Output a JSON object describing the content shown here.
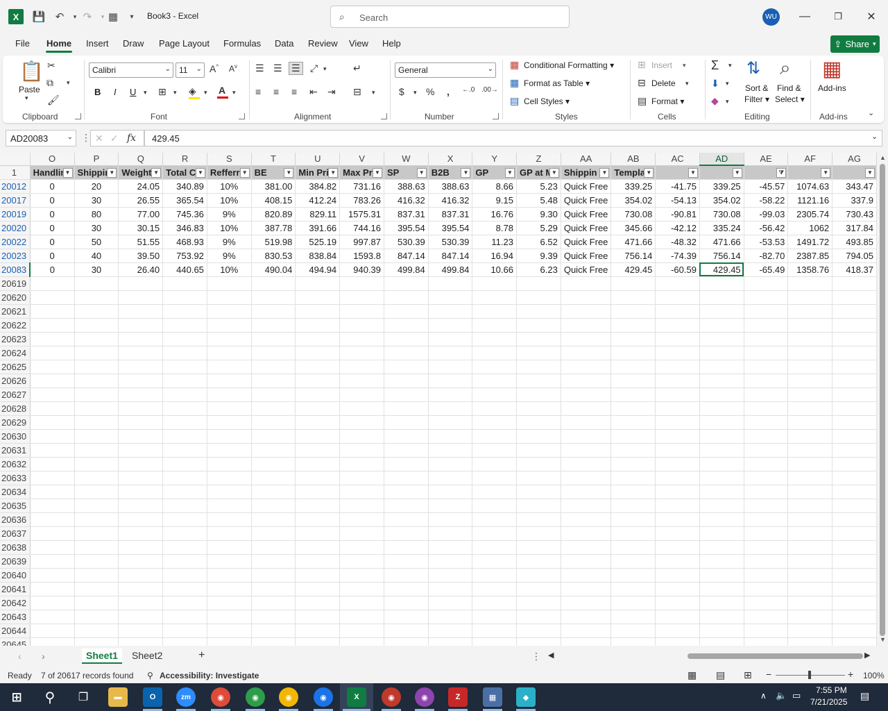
{
  "window": {
    "title": "Book3  -  Excel",
    "search_placeholder": "Search",
    "user_initials": "WU"
  },
  "menu": {
    "tabs": [
      "File",
      "Home",
      "Insert",
      "Draw",
      "Page Layout",
      "Formulas",
      "Data",
      "Review",
      "View",
      "Help"
    ],
    "active": "Home",
    "share_label": "Share"
  },
  "ribbon": {
    "clipboard": {
      "paste": "Paste",
      "group": "Clipboard"
    },
    "font": {
      "name": "Calibri",
      "size": "11",
      "bold": "B",
      "italic": "I",
      "underline": "U",
      "group": "Font"
    },
    "alignment": {
      "group": "Alignment"
    },
    "number": {
      "format": "General",
      "group": "Number"
    },
    "styles": {
      "conditional": "Conditional Formatting",
      "format_table": "Format as Table",
      "cell_styles": "Cell Styles",
      "group": "Styles"
    },
    "cells": {
      "insert": "Insert",
      "delete": "Delete",
      "format": "Format",
      "group": "Cells"
    },
    "editing": {
      "sort": "Sort &",
      "sort2": "Filter",
      "find": "Find &",
      "find2": "Select",
      "group": "Editing"
    },
    "addins": {
      "label": "Add-ins",
      "group": "Add-ins"
    }
  },
  "formula_bar": {
    "name_box": "AD20083",
    "fx": "fx",
    "value": "429.45"
  },
  "grid": {
    "columns": [
      "O",
      "P",
      "Q",
      "R",
      "S",
      "T",
      "U",
      "V",
      "W",
      "X",
      "Y",
      "Z",
      "AA",
      "AB",
      "AC",
      "AD",
      "AE",
      "AF",
      "AG"
    ],
    "selected_column": "AD",
    "header_row": {
      "row_num": "1",
      "cells": [
        "Handlin",
        "Shippin",
        "Weight",
        "Total C",
        "Refferr",
        "BE",
        "Min Pri",
        "Max Pr",
        "SP",
        "B2B",
        "GP",
        "GP at M",
        "Shippin",
        "Templat",
        "",
        "",
        "",
        "",
        ""
      ]
    },
    "rows": [
      {
        "num": "20012",
        "cells": [
          "0",
          "20",
          "24.05",
          "340.89",
          "10%",
          "381.00",
          "384.82",
          "731.16",
          "388.63",
          "388.63",
          "8.66",
          "5.23",
          "Quick Free",
          "339.25",
          "-41.75",
          "339.25",
          "-45.57",
          "1074.63",
          "343.47"
        ]
      },
      {
        "num": "20017",
        "cells": [
          "0",
          "30",
          "26.55",
          "365.54",
          "10%",
          "408.15",
          "412.24",
          "783.26",
          "416.32",
          "416.32",
          "9.15",
          "5.48",
          "Quick Free",
          "354.02",
          "-54.13",
          "354.02",
          "-58.22",
          "1121.16",
          "337.9"
        ]
      },
      {
        "num": "20019",
        "cells": [
          "0",
          "80",
          "77.00",
          "745.36",
          "9%",
          "820.89",
          "829.11",
          "1575.31",
          "837.31",
          "837.31",
          "16.76",
          "9.30",
          "Quick Free",
          "730.08",
          "-90.81",
          "730.08",
          "-99.03",
          "2305.74",
          "730.43"
        ]
      },
      {
        "num": "20020",
        "cells": [
          "0",
          "30",
          "30.15",
          "346.83",
          "10%",
          "387.78",
          "391.66",
          "744.16",
          "395.54",
          "395.54",
          "8.78",
          "5.29",
          "Quick Free",
          "345.66",
          "-42.12",
          "335.24",
          "-56.42",
          "1062",
          "317.84"
        ]
      },
      {
        "num": "20022",
        "cells": [
          "0",
          "50",
          "51.55",
          "468.93",
          "9%",
          "519.98",
          "525.19",
          "997.87",
          "530.39",
          "530.39",
          "11.23",
          "6.52",
          "Quick Free",
          "471.66",
          "-48.32",
          "471.66",
          "-53.53",
          "1491.72",
          "493.85"
        ]
      },
      {
        "num": "20023",
        "cells": [
          "0",
          "40",
          "39.50",
          "753.92",
          "9%",
          "830.53",
          "838.84",
          "1593.8",
          "847.14",
          "847.14",
          "16.94",
          "9.39",
          "Quick Free",
          "756.14",
          "-74.39",
          "756.14",
          "-82.70",
          "2387.85",
          "794.05"
        ]
      },
      {
        "num": "20083",
        "cells": [
          "0",
          "30",
          "26.40",
          "440.65",
          "10%",
          "490.04",
          "494.94",
          "940.39",
          "499.84",
          "499.84",
          "10.66",
          "6.23",
          "Quick Free",
          "429.45",
          "-60.59",
          "429.45",
          "-65.49",
          "1358.76",
          "418.37"
        ]
      }
    ],
    "empty_rows": [
      "20619",
      "20620",
      "20621",
      "20622",
      "20623",
      "20624",
      "20625",
      "20626",
      "20627",
      "20628",
      "20629",
      "20630",
      "20631",
      "20632",
      "20633",
      "20634",
      "20635",
      "20636",
      "20637",
      "20638",
      "20639",
      "20640",
      "20641",
      "20642",
      "20643",
      "20644",
      "20645"
    ]
  },
  "sheets": {
    "tabs": [
      "Sheet1",
      "Sheet2"
    ],
    "active": "Sheet1"
  },
  "status": {
    "mode": "Ready",
    "records": "7 of 20617 records found",
    "accessibility": "Accessibility: Investigate",
    "zoom": "100%"
  },
  "taskbar": {
    "time": "7:55 PM",
    "date": "7/21/2025"
  },
  "colors": {
    "accent": "#107c41",
    "filtered_row": "#1a5fb4"
  }
}
